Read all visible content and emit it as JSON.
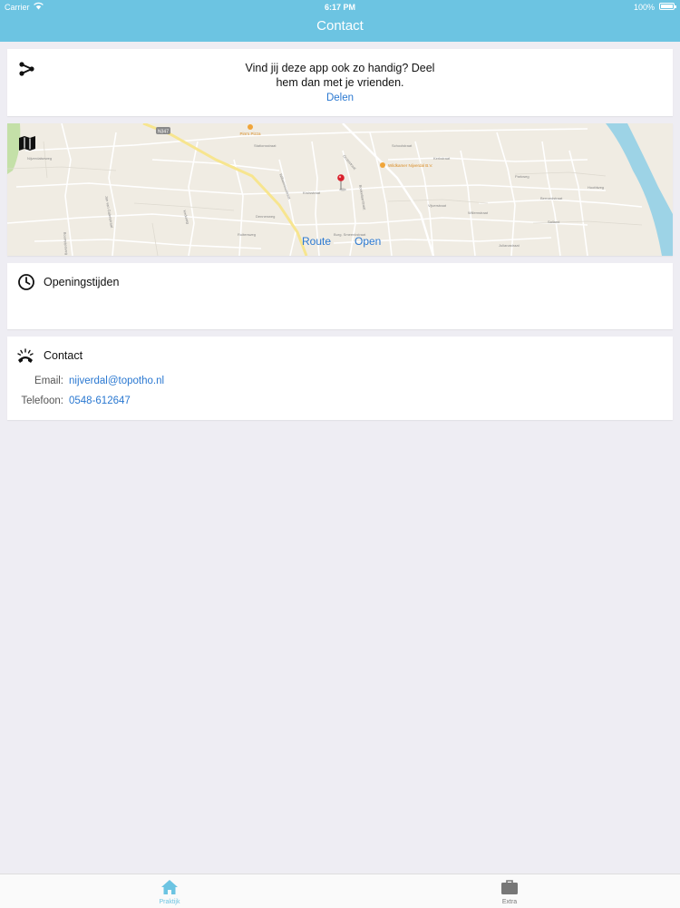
{
  "status_bar": {
    "carrier": "Carrier",
    "time": "6:17 PM",
    "battery": "100%"
  },
  "nav": {
    "title": "Contact"
  },
  "share": {
    "icon": "share-icon",
    "text": "Vind jij deze app ook zo handig? Deel hem dan met je vrienden.",
    "link_label": "Delen"
  },
  "map": {
    "icon": "map-icon",
    "route_label": "Route",
    "open_label": "Open",
    "road_label": "N347",
    "poi_labels": [
      "Pim's Pizza",
      "Wildkamer Nijverdal B.V."
    ],
    "street_labels": [
      "Schoolstraat",
      "Grotestraat",
      "Kerkstraat",
      "Wilhelminastraat",
      "Bernardstraat",
      "Stationsstraat",
      "Dennenweg",
      "Salland",
      "Willemstraat",
      "Julianastraat",
      "Nijverdalseweg",
      "Kruisstraat",
      "Vijverstraat",
      "Jan van Galenstraat",
      "Hoofdweg",
      "Burg. Smeenkstraat",
      "Kerkweg",
      "Ruitersweg",
      "Boompjesweg",
      "Bonkelaarstraat",
      "Parkweg"
    ],
    "colors": {
      "land": "#f0ece3",
      "water": "#9dd3e6",
      "park": "#c4e0a8",
      "main_road": "#f7e58f",
      "pin": "#d9202c"
    }
  },
  "hours": {
    "icon": "clock-icon",
    "title": "Openingstijden"
  },
  "contact": {
    "icon": "phone-icon",
    "title": "Contact",
    "email_label": "Email:",
    "email_value": "nijverdal@topotho.nl",
    "phone_label": "Telefoon:",
    "phone_value": "0548-612647"
  },
  "tabbar": {
    "items": [
      {
        "label": "Praktijk",
        "icon": "home-icon",
        "active": true
      },
      {
        "label": "Extra",
        "icon": "briefcase-icon",
        "active": false
      }
    ]
  },
  "colors": {
    "accent": "#6cc4e2",
    "link": "#2a78d1",
    "background": "#eeedf3"
  }
}
